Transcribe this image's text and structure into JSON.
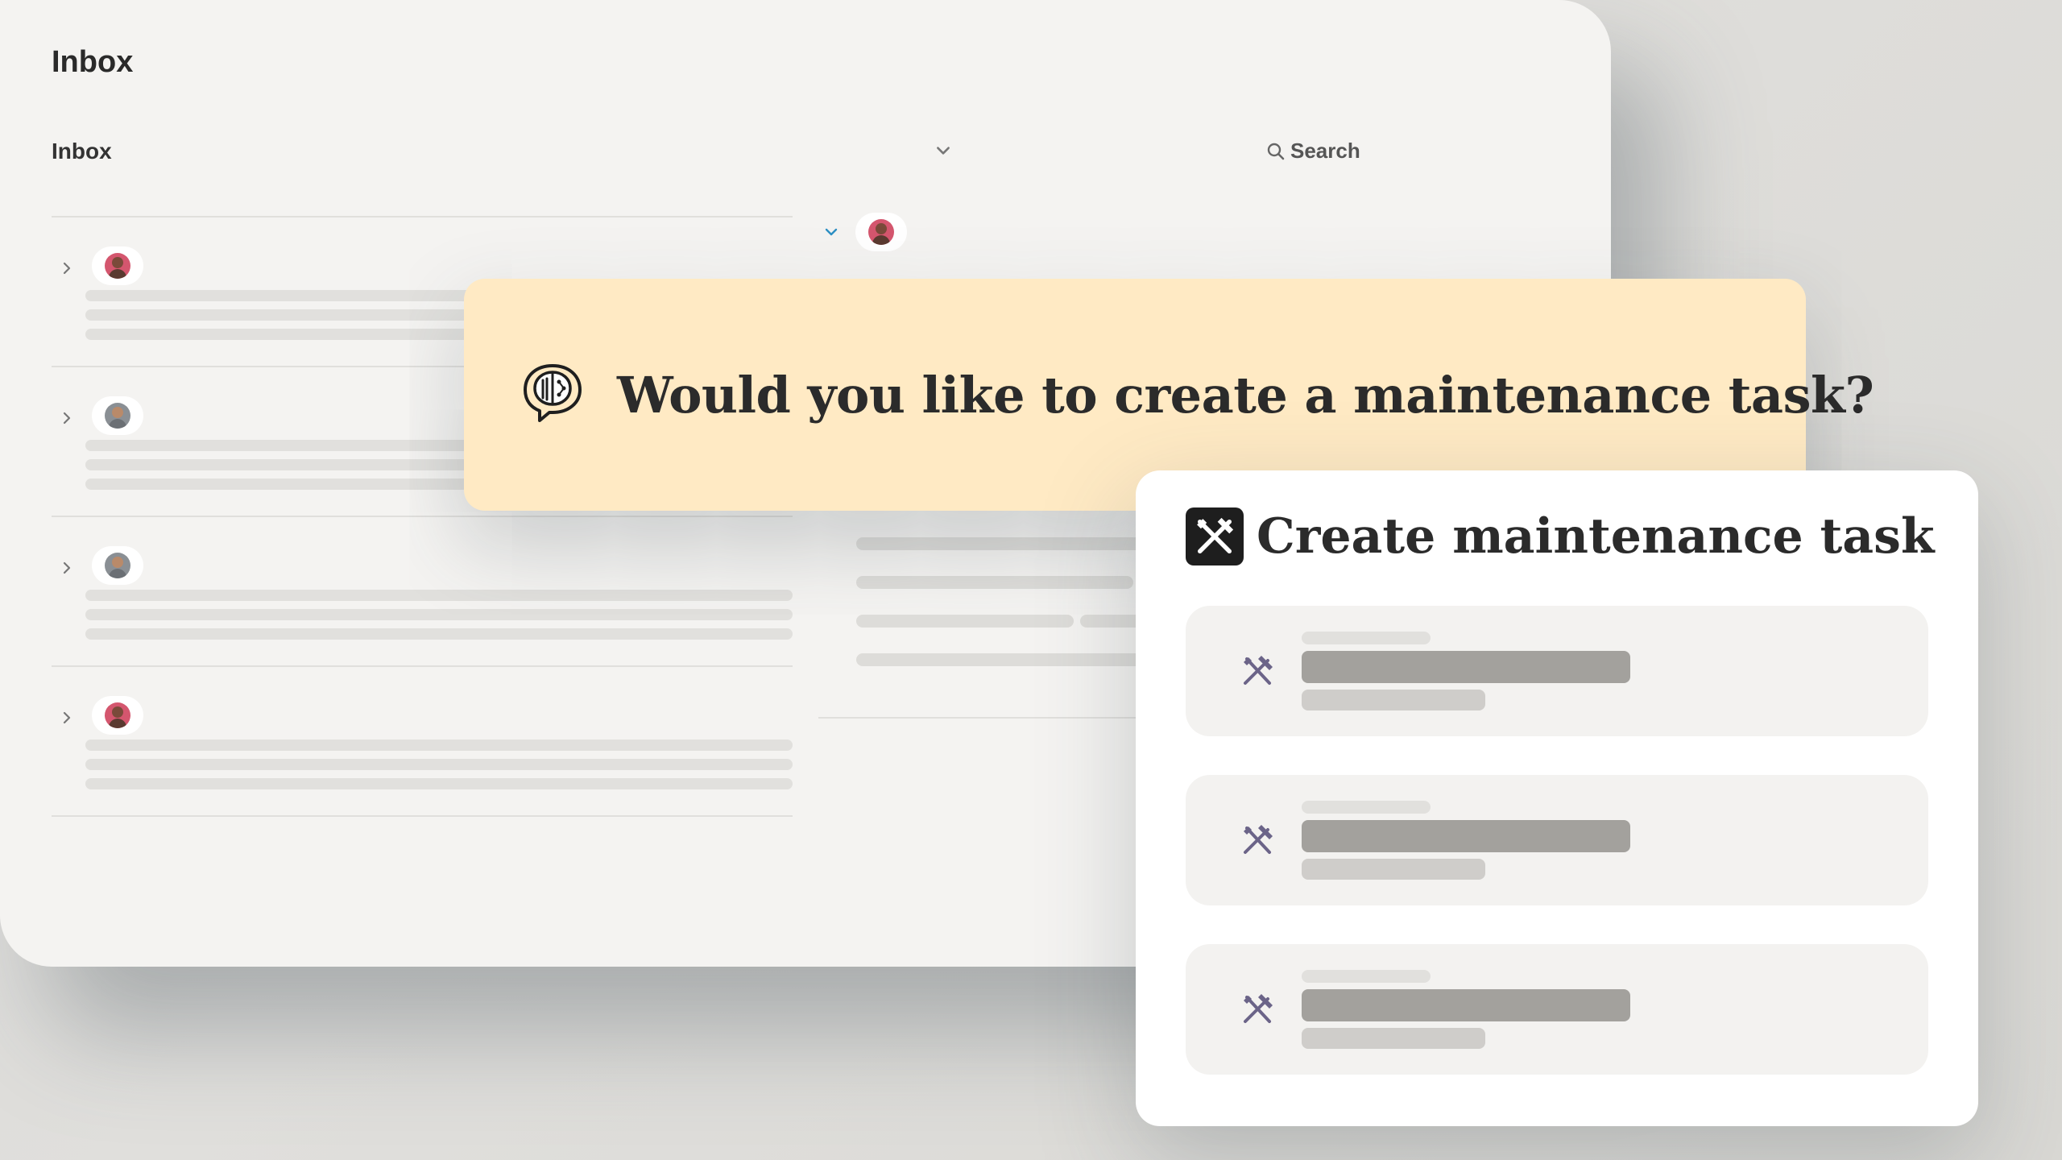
{
  "window": {
    "title": "Inbox",
    "filter_label": "Inbox",
    "search_label": "Search"
  },
  "list": {
    "items": [
      {
        "avatar": "person-woman-avatar",
        "expanded": false
      },
      {
        "avatar": "person-man-avatar",
        "expanded": false
      },
      {
        "avatar": "person-man-avatar",
        "expanded": false
      },
      {
        "avatar": "person-woman-avatar",
        "expanded": false
      }
    ]
  },
  "detail": {
    "expanded": true,
    "avatar": "person-woman-avatar"
  },
  "prompt": {
    "icon": "brain-speech-icon",
    "text": "Would you like to create a maintenance task?",
    "background": "#ffeac4"
  },
  "card": {
    "icon": "tools-icon",
    "title": "Create maintenance task",
    "tasks": [
      {
        "icon": "tools-icon"
      },
      {
        "icon": "tools-icon"
      },
      {
        "icon": "tools-icon"
      }
    ],
    "icon_color": "#6b6488"
  }
}
